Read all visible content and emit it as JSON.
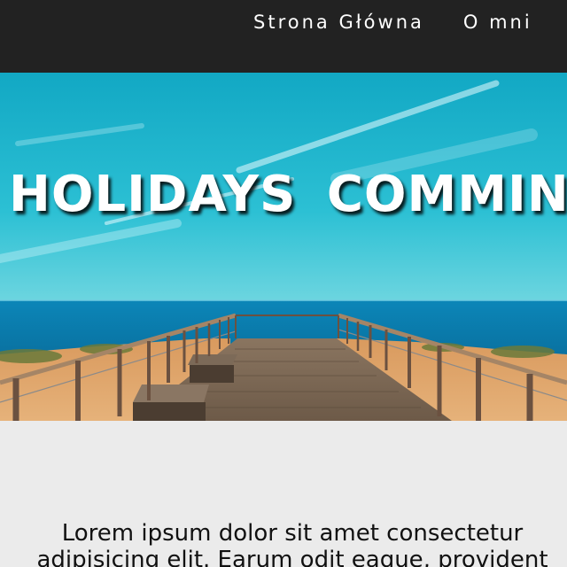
{
  "nav": {
    "items": [
      {
        "label": "Strona Główna"
      },
      {
        "label": "O mni"
      }
    ]
  },
  "hero": {
    "title": "HOLIDAYS COMMING"
  },
  "content": {
    "text": "Lorem ipsum dolor sit amet consectetur adipisicing elit. Earum odit eaque, provident"
  },
  "colors": {
    "navbar": "#222222",
    "page_background": "#ebebeb",
    "sky": "#1ab3cc",
    "sea": "#0a7fb0"
  }
}
